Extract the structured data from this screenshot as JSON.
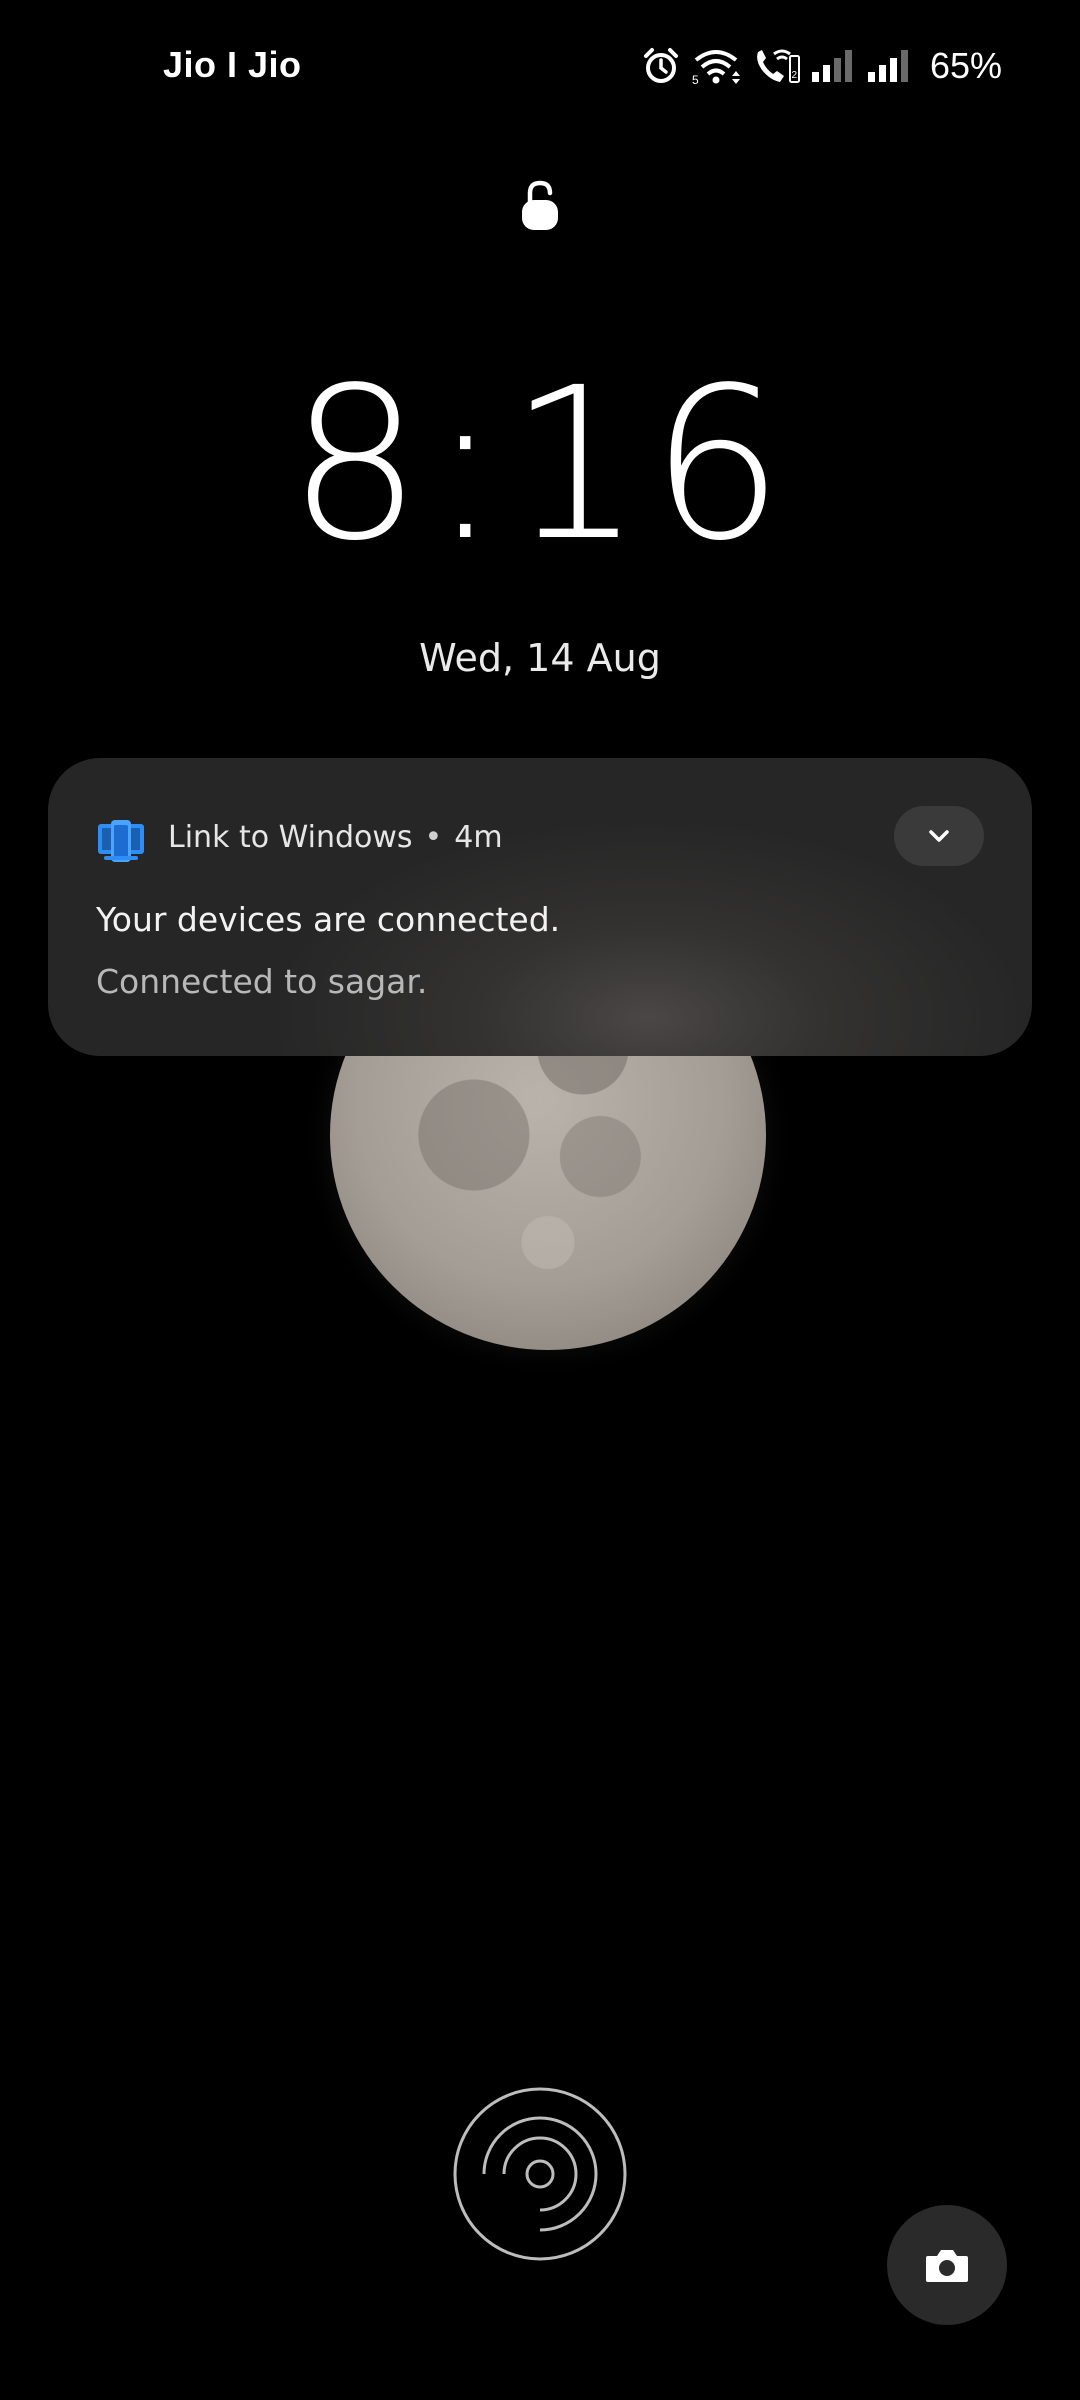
{
  "status_bar": {
    "carrier": "Jio I Jio",
    "battery": "65%",
    "icons": [
      "alarm-icon",
      "wifi-icon",
      "wifi-calling-icon",
      "signal-sim1-icon",
      "signal-sim2-icon"
    ]
  },
  "lockscreen": {
    "lock_icon": "lock-icon",
    "time": "8:16",
    "date": "Wed, 14 Aug"
  },
  "notification": {
    "app_name": "Link to Windows",
    "separator": "•",
    "age": "4m",
    "title": "Your devices are connected.",
    "body": "Connected to sagar.",
    "app_icon": "link-to-windows-icon",
    "expand_icon": "chevron-down-icon",
    "accent": "#2f8ef4"
  },
  "bottom": {
    "fingerprint_icon": "fingerprint-icon",
    "camera_icon": "camera-icon"
  }
}
